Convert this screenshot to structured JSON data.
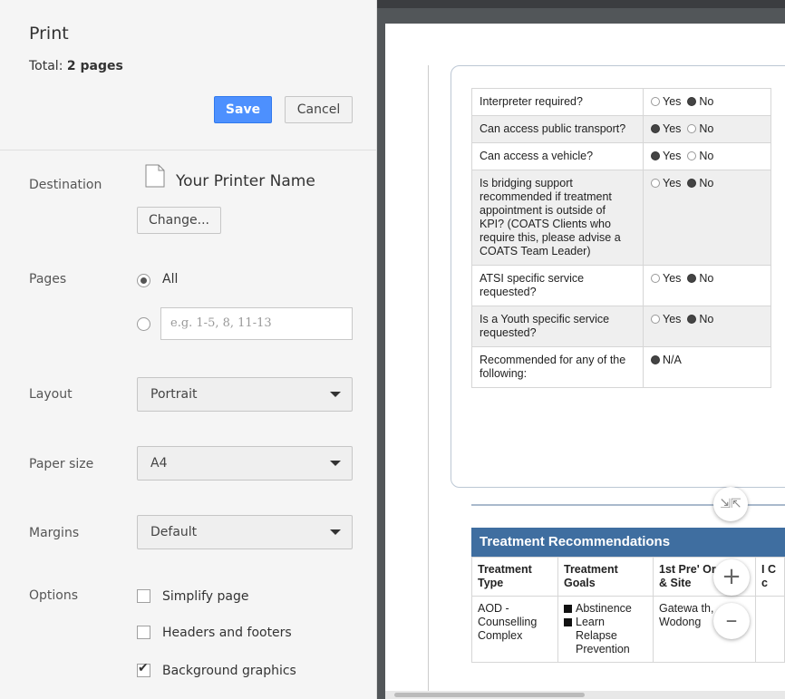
{
  "panel": {
    "title": "Print",
    "total_label": "Total:",
    "total_value": "2 pages",
    "save_label": "Save",
    "cancel_label": "Cancel",
    "destination_label": "Destination",
    "destination_name": "Your Printer Name",
    "change_label": "Change...",
    "pages_label": "Pages",
    "pages_all": "All",
    "pages_range_placeholder": "e.g. 1-5, 8, 11-13",
    "layout_label": "Layout",
    "layout_value": "Portrait",
    "paper_label": "Paper size",
    "paper_value": "A4",
    "margins_label": "Margins",
    "margins_value": "Default",
    "options_label": "Options",
    "option_simplify": "Simplify page",
    "option_headers": "Headers and footers",
    "option_background": "Background graphics"
  },
  "preview": {
    "questions": [
      {
        "q": "Interpreter required?",
        "yes": "Yes",
        "no": "No",
        "answer": "no"
      },
      {
        "q": "Can access public transport?",
        "yes": "Yes",
        "no": "No",
        "answer": "yes"
      },
      {
        "q": "Can access a vehicle?",
        "yes": "Yes",
        "no": "No",
        "answer": "yes"
      },
      {
        "q": "Is bridging support recommended if treatment appointment is outside of KPI?  (COATS Clients who require this, please advise a COATS Team Leader)",
        "yes": "Yes",
        "no": "No",
        "answer": "no"
      },
      {
        "q": "ATSI specific service requested?",
        "yes": "Yes",
        "no": "No",
        "answer": "no"
      },
      {
        "q": "Is a Youth specific service requested?",
        "yes": "Yes",
        "no": "No",
        "answer": "no"
      },
      {
        "q": "Recommended for any of the following:",
        "na": "N/A"
      }
    ],
    "treatment_title": "Treatment Recommendations",
    "col_type": "Treatment Type",
    "col_goals": "Treatment Goals",
    "col_site": "1st Pre' Organi: & Site",
    "col_extra": "I C c",
    "row_type": "AOD - Counselling Complex",
    "goal_1": "Abstinence",
    "goal_2": "Learn Relapse Prevention",
    "row_site": "Gatewa th, Wodong",
    "collapse_icon": "⇲⇱",
    "zoom_in": "+",
    "zoom_out": "–"
  },
  "colors": {
    "save": "#4d90fe",
    "header_blue": "#3f6ea0",
    "preview_bg": "#525659"
  }
}
